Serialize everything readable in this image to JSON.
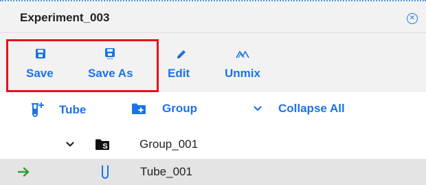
{
  "panel": {
    "title": "Experiment_003",
    "close_icon": "close-circle-icon"
  },
  "toolbar": {
    "items": [
      {
        "label": "Save",
        "icon": "save-icon"
      },
      {
        "label": "Save As",
        "icon": "save-as-icon"
      },
      {
        "label": "Edit",
        "icon": "pencil-icon"
      },
      {
        "label": "Unmix",
        "icon": "unmix-icon"
      }
    ],
    "highlight_color": "#e8101a"
  },
  "actions": {
    "tube_label": "Tube",
    "group_label": "Group",
    "collapse_label": "Collapse All"
  },
  "tree": {
    "group": {
      "label": "Group_001",
      "badge": "S",
      "expanded": true
    },
    "tube": {
      "label": "Tube_001",
      "selected": true
    }
  },
  "colors": {
    "accent": "#1a73e8",
    "arrow": "#2e9d3a",
    "selected_row": "#e4e4e4",
    "toolbar_bg": "#f2f2f2"
  }
}
